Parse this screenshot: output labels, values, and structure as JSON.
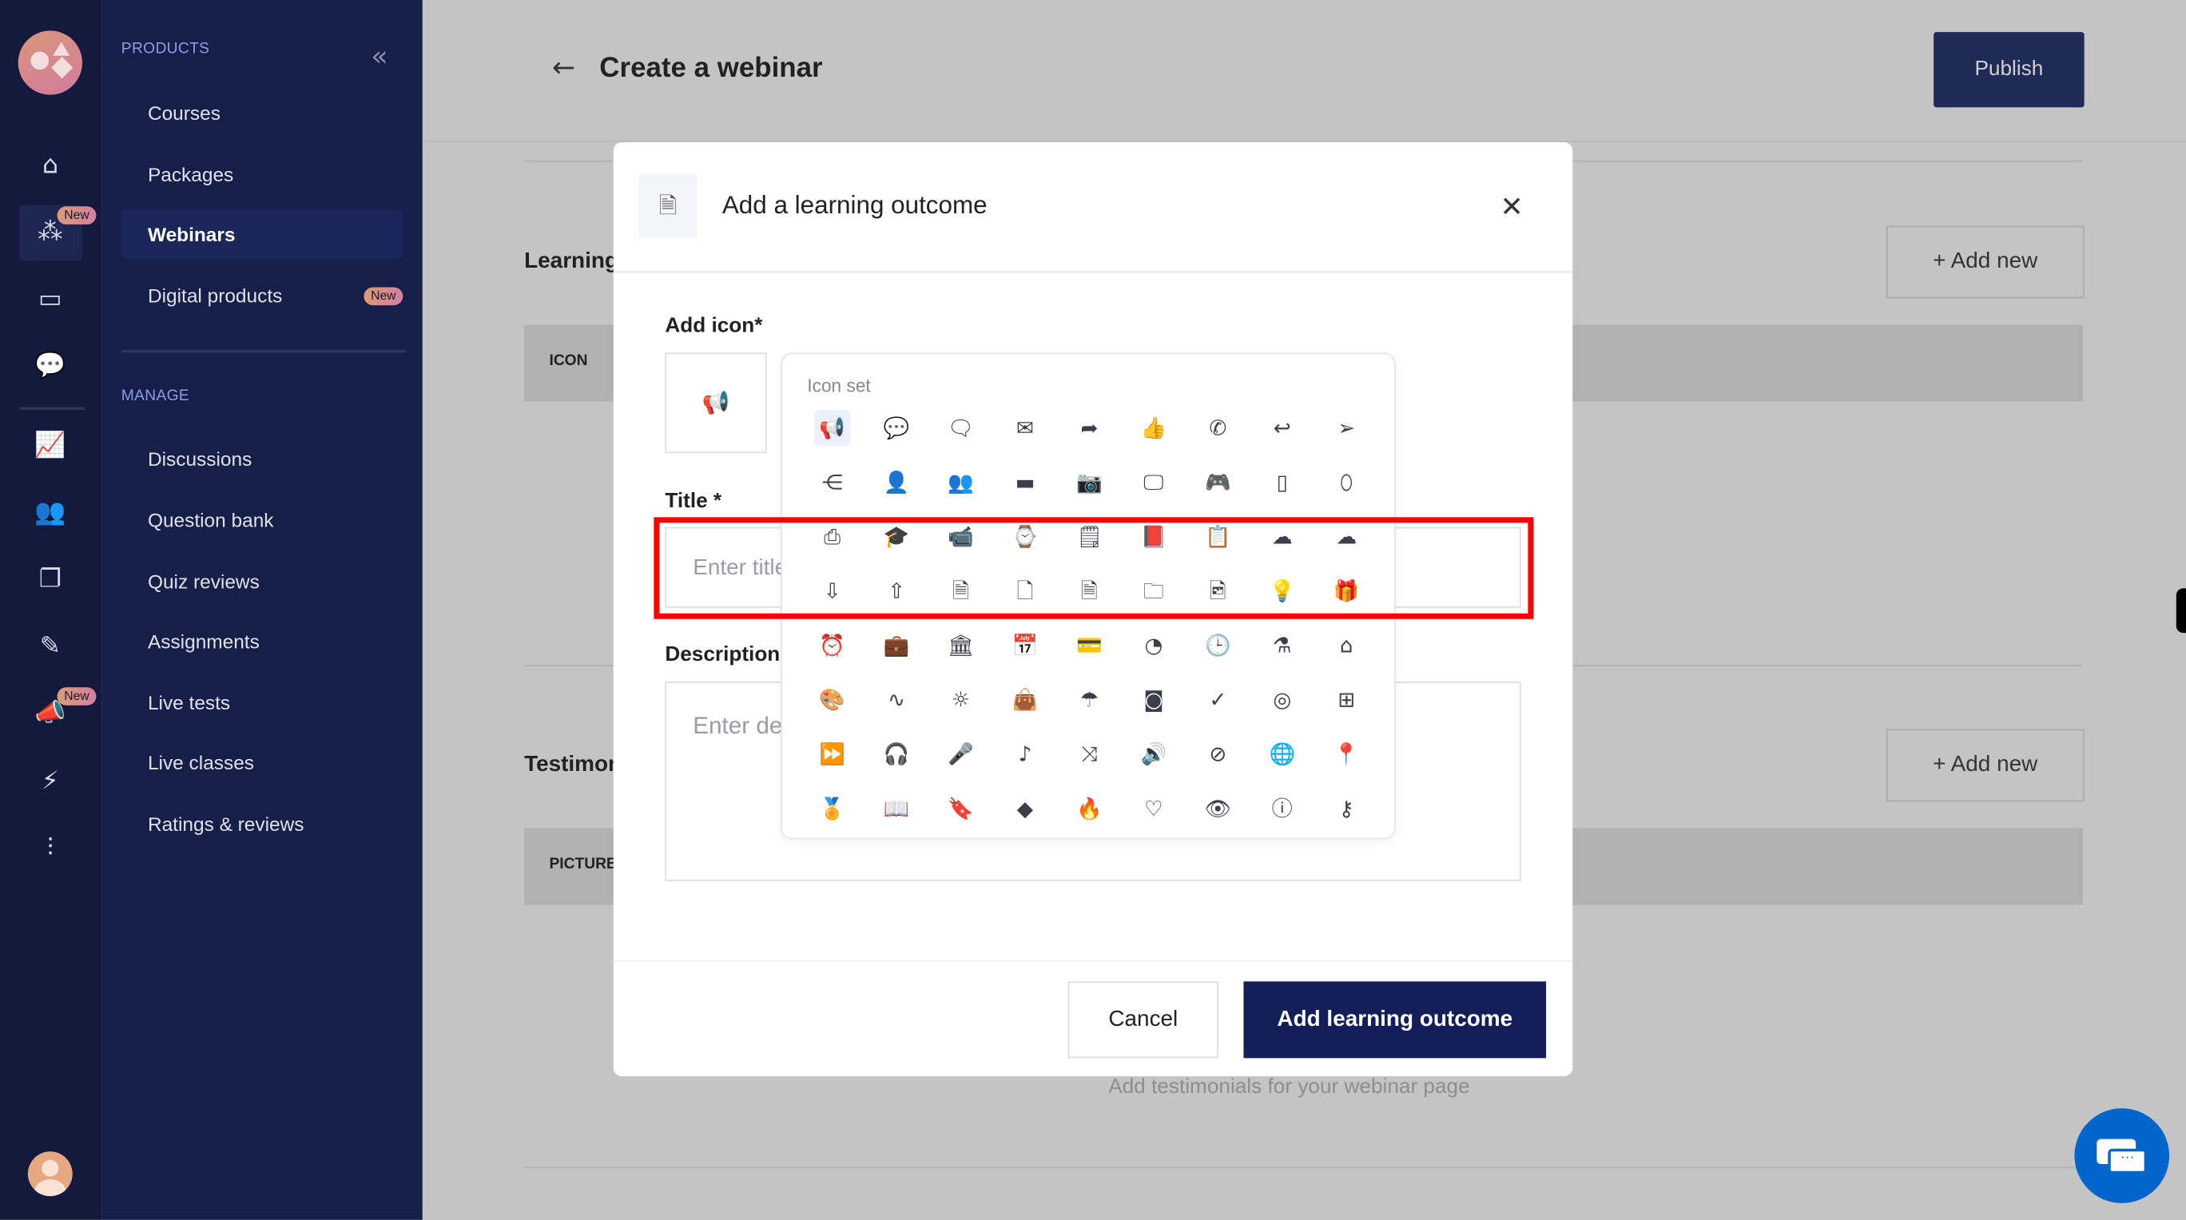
{
  "sidebar": {
    "products_heading": "PRODUCTS",
    "manage_heading": "MANAGE",
    "new_badge": "New",
    "products": [
      {
        "label": "Courses"
      },
      {
        "label": "Packages"
      },
      {
        "label": "Webinars",
        "active": true
      },
      {
        "label": "Digital products",
        "badge": "New"
      }
    ],
    "manage": [
      {
        "label": "Discussions"
      },
      {
        "label": "Question bank"
      },
      {
        "label": "Quiz reviews"
      },
      {
        "label": "Assignments"
      },
      {
        "label": "Live tests"
      },
      {
        "label": "Live classes"
      },
      {
        "label": "Ratings & reviews"
      }
    ],
    "rail_icons": [
      "home-icon",
      "webinar-icon",
      "ticket-icon",
      "chat-icon",
      "analytics-icon",
      "users-icon",
      "copy-icon",
      "tools-icon",
      "megaphone-icon",
      "bolt-icon",
      "sliders-icon"
    ]
  },
  "header": {
    "title": "Create a webinar",
    "publish_label": "Publish"
  },
  "page": {
    "learning_heading": "Learning",
    "testimonials_heading": "Testimon",
    "add_new_label": "Add new",
    "icon_col": "ICON",
    "picture_col": "PICTURE",
    "testimonial_hint": "Add testimonials for your webinar page"
  },
  "modal": {
    "title": "Add a learning outcome",
    "add_icon_label": "Add icon*",
    "title_label": "Title *",
    "title_placeholder": "Enter title",
    "description_label": "Description",
    "description_placeholder": "Enter description",
    "cancel_label": "Cancel",
    "submit_label": "Add learning outcome",
    "selected_icon": "megaphone",
    "icon_set_label": "Icon set",
    "icons": [
      "megaphone",
      "chat-dots",
      "speech-bubble",
      "envelope",
      "share-forward",
      "thumbs-up",
      "phone",
      "reply",
      "send",
      "share-nodes",
      "user",
      "user-add",
      "battery",
      "camera",
      "monitor",
      "gamepad",
      "smartphone",
      "mouse",
      "printer",
      "graduation-cap",
      "video-camera",
      "smartwatch",
      "document-text",
      "book-bookmark",
      "clipboard",
      "cloud",
      "cloud-check",
      "cloud-download",
      "cloud-upload",
      "file-text",
      "file",
      "file-user",
      "folder",
      "file-image",
      "lightbulb",
      "gift",
      "alarm-clock",
      "briefcase",
      "bank",
      "calendar",
      "credit-card",
      "pie-chart",
      "clock",
      "flask",
      "home",
      "palette",
      "pulse",
      "sun",
      "shopping-bag",
      "umbrella",
      "wallet",
      "check",
      "broadcast",
      "grid",
      "fast-forward",
      "headphones",
      "microphone",
      "music-note",
      "shuffle",
      "speaker",
      "compass",
      "globe",
      "map-pin",
      "award",
      "book-open",
      "bookmark",
      "diamond",
      "flame",
      "heart",
      "eye",
      "info",
      "key"
    ]
  },
  "colors": {
    "primary": "#141f5a",
    "sidebar": "#161f48",
    "highlight": "#ff0000",
    "chat": "#0066cc"
  }
}
